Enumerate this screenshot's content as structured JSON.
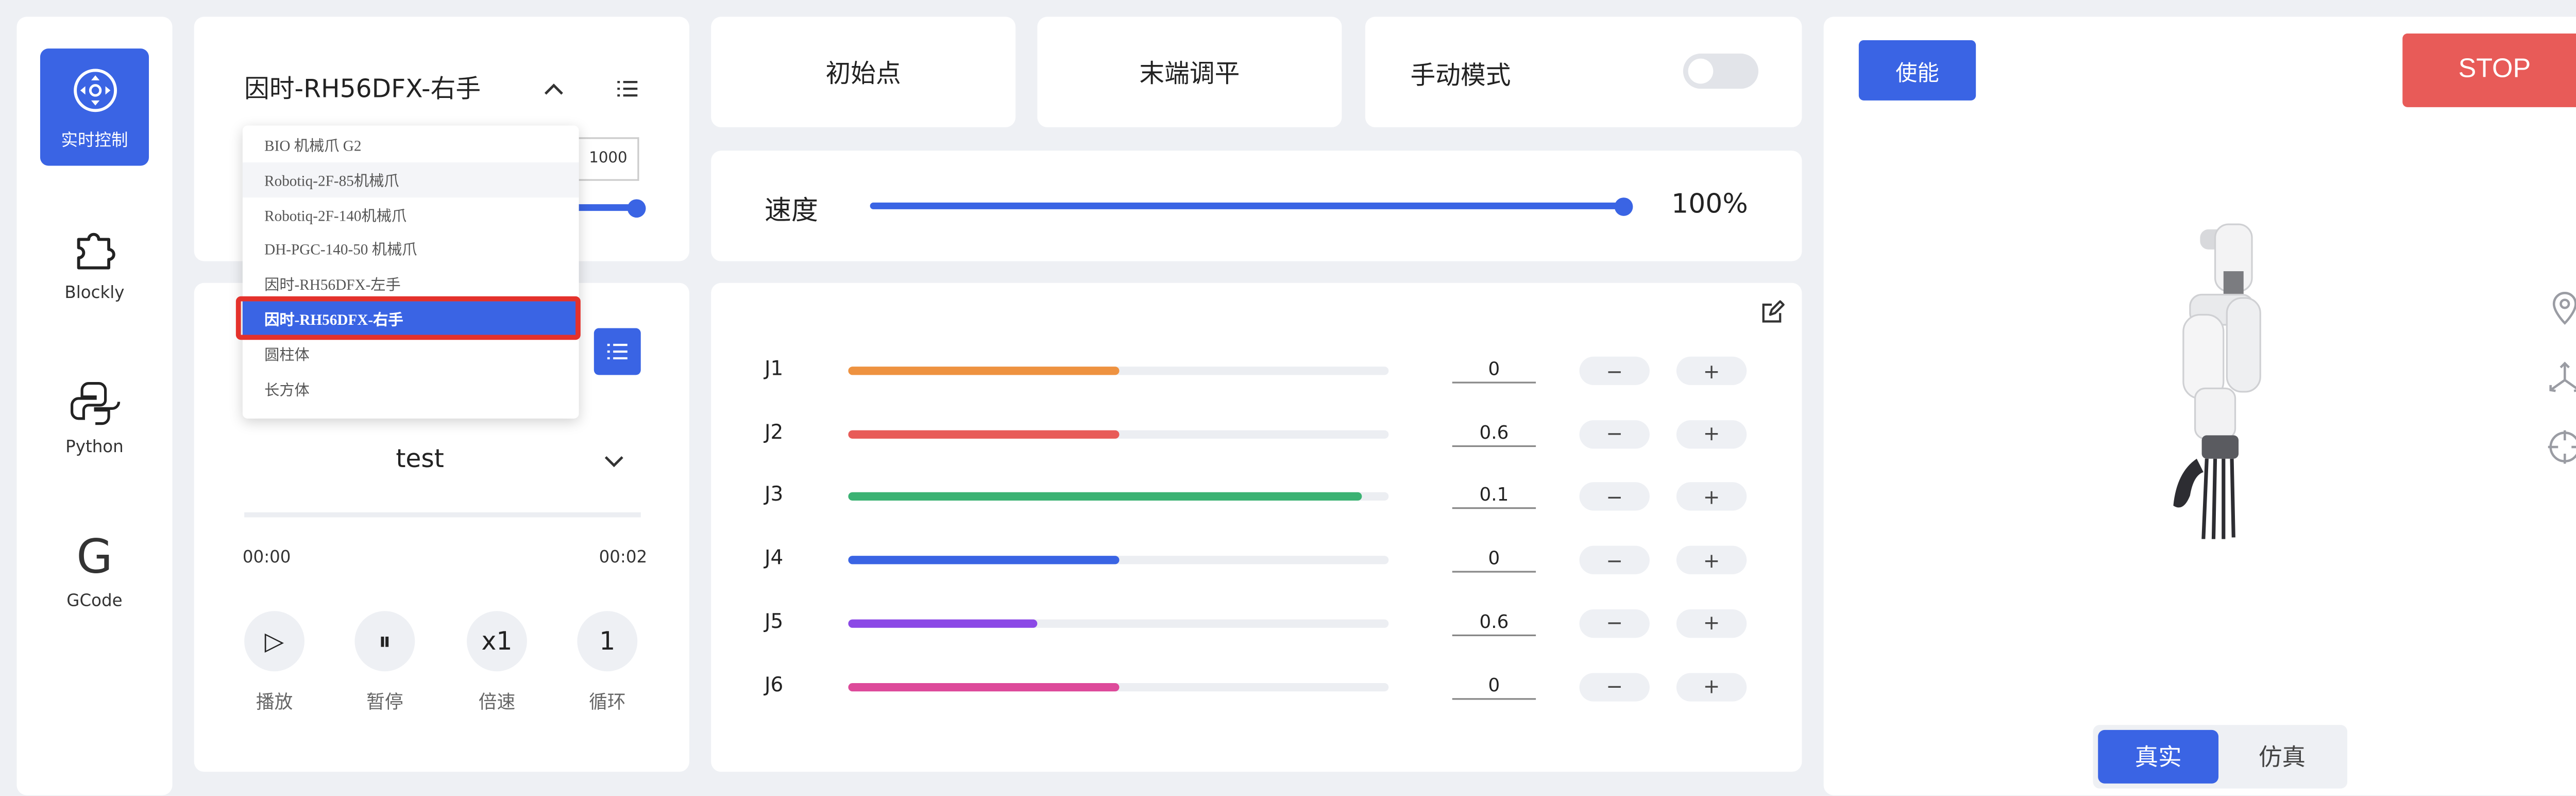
{
  "nav": {
    "items": [
      {
        "label": "实时控制",
        "icon": "joystick-icon",
        "active": true
      },
      {
        "label": "Blockly",
        "icon": "puzzle-icon",
        "active": false
      },
      {
        "label": "Python",
        "icon": "python-icon",
        "active": false
      },
      {
        "label": "GCode",
        "icon": "g-letter-icon",
        "glyph": "G",
        "active": false
      }
    ]
  },
  "gripper": {
    "title": "因时-RH56DFX-右手",
    "value": "1000",
    "options": [
      "BIO 机械爪 G2",
      "Robotiq-2F-85机械爪",
      "Robotiq-2F-140机械爪",
      "DH-PGC-140-50 机械爪",
      "因时-RH56DFX-左手",
      "因时-RH56DFX-右手",
      "圆柱体",
      "长方体"
    ],
    "selected_index": 5,
    "hover_index": 1
  },
  "program": {
    "name": "test",
    "time_start": "00:00",
    "time_end": "00:02",
    "controls": [
      {
        "glyph": "▷",
        "label": "播放",
        "icon": "play-icon"
      },
      {
        "glyph": "⏸",
        "label": "暂停",
        "icon": "pause-icon"
      },
      {
        "glyph": "x1",
        "label": "倍速",
        "icon": "speed-multiplier"
      },
      {
        "glyph": "1",
        "label": "循环",
        "icon": "loop-count"
      }
    ]
  },
  "toolbar": {
    "home_label": "初始点",
    "level_label": "末端调平",
    "manual_label": "手动模式",
    "manual_on": false
  },
  "speed": {
    "label": "速度",
    "value_text": "100%",
    "value": 100
  },
  "joints": [
    {
      "name": "J1",
      "value": "0",
      "fill": 0.5,
      "color": "#ee9240"
    },
    {
      "name": "J2",
      "value": "0.6",
      "fill": 0.5,
      "color": "#e85b58"
    },
    {
      "name": "J3",
      "value": "0.1",
      "fill": 0.95,
      "color": "#3bb273"
    },
    {
      "name": "J4",
      "value": "0",
      "fill": 0.5,
      "color": "#3a64e4"
    },
    {
      "name": "J5",
      "value": "0.6",
      "fill": 0.35,
      "color": "#8b48e6"
    },
    {
      "name": "J6",
      "value": "0",
      "fill": 0.5,
      "color": "#dd4a9a"
    }
  ],
  "joint_buttons": {
    "minus": "−",
    "plus": "+"
  },
  "right": {
    "enable_label": "使能",
    "stop_label": "STOP",
    "mode_real": "真实",
    "mode_sim": "仿真",
    "active_mode": "real"
  },
  "colors": {
    "accent": "#3a64e4",
    "stop": "#e85b58",
    "dropdown_highlight": "#e4312b"
  }
}
